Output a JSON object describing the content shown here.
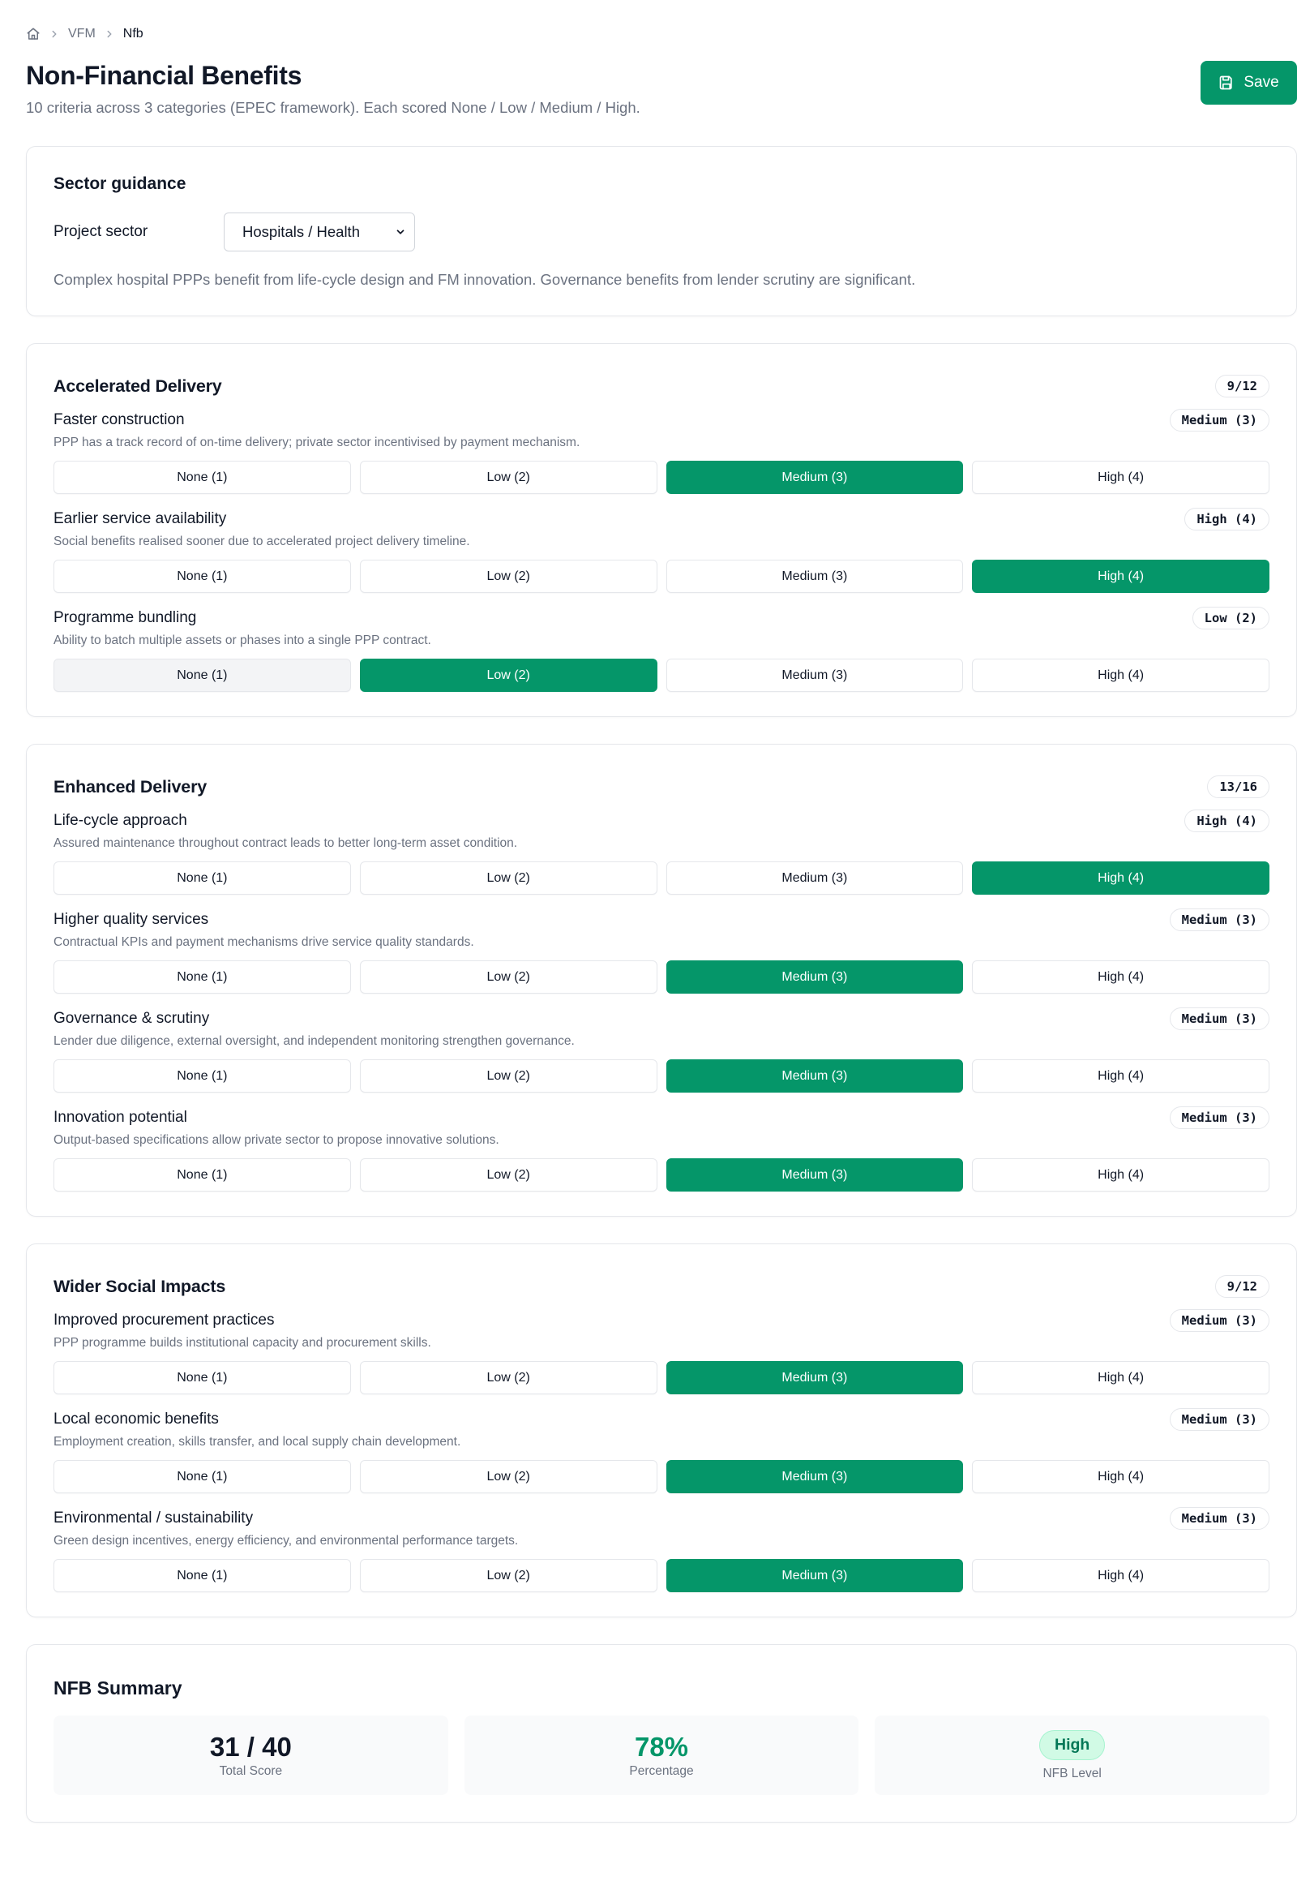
{
  "breadcrumb": {
    "items": [
      "VFM",
      "Nfb"
    ]
  },
  "page": {
    "title": "Non-Financial Benefits",
    "subtitle": "10 criteria across 3 categories (EPEC framework). Each scored None / Low / Medium / High.",
    "save_label": "Save"
  },
  "guidance": {
    "title": "Sector guidance",
    "sector_label": "Project sector",
    "sector_value": "Hospitals / Health",
    "text": "Complex hospital PPPs benefit from life-cycle design and FM innovation. Governance benefits from lender scrutiny are significant."
  },
  "option_labels": [
    "None (1)",
    "Low (2)",
    "Medium (3)",
    "High (4)"
  ],
  "categories": [
    {
      "title": "Accelerated Delivery",
      "score": "9/12",
      "criteria": [
        {
          "name": "Faster construction",
          "desc": "PPP has a track record of on-time delivery; private sector incentivised by payment mechanism.",
          "badge": "Medium (3)",
          "selected": 2
        },
        {
          "name": "Earlier service availability",
          "desc": "Social benefits realised sooner due to accelerated project delivery timeline.",
          "badge": "High (4)",
          "selected": 3
        },
        {
          "name": "Programme bundling",
          "desc": "Ability to batch multiple assets or phases into a single PPP contract.",
          "badge": "Low (2)",
          "selected": 1,
          "hover": 0
        }
      ]
    },
    {
      "title": "Enhanced Delivery",
      "score": "13/16",
      "criteria": [
        {
          "name": "Life-cycle approach",
          "desc": "Assured maintenance throughout contract leads to better long-term asset condition.",
          "badge": "High (4)",
          "selected": 3
        },
        {
          "name": "Higher quality services",
          "desc": "Contractual KPIs and payment mechanisms drive service quality standards.",
          "badge": "Medium (3)",
          "selected": 2
        },
        {
          "name": "Governance & scrutiny",
          "desc": "Lender due diligence, external oversight, and independent monitoring strengthen governance.",
          "badge": "Medium (3)",
          "selected": 2
        },
        {
          "name": "Innovation potential",
          "desc": "Output-based specifications allow private sector to propose innovative solutions.",
          "badge": "Medium (3)",
          "selected": 2
        }
      ]
    },
    {
      "title": "Wider Social Impacts",
      "score": "9/12",
      "criteria": [
        {
          "name": "Improved procurement practices",
          "desc": "PPP programme builds institutional capacity and procurement skills.",
          "badge": "Medium (3)",
          "selected": 2
        },
        {
          "name": "Local economic benefits",
          "desc": "Employment creation, skills transfer, and local supply chain development.",
          "badge": "Medium (3)",
          "selected": 2
        },
        {
          "name": "Environmental / sustainability",
          "desc": "Green design incentives, energy efficiency, and environmental performance targets.",
          "badge": "Medium (3)",
          "selected": 2
        }
      ]
    }
  ],
  "summary": {
    "title": "NFB Summary",
    "total_value": "31 / 40",
    "total_label": "Total Score",
    "percent_value": "78%",
    "percent_label": "Percentage",
    "level_value": "High",
    "level_label": "NFB Level"
  },
  "colors": {
    "accent": "#059669",
    "muted_text": "#6b7280",
    "level_pill_bg": "#d1fae5"
  },
  "icons": {
    "home": "home-icon",
    "separator": "chevron-right-icon",
    "save": "save-icon",
    "select": "chevron-down-icon"
  }
}
